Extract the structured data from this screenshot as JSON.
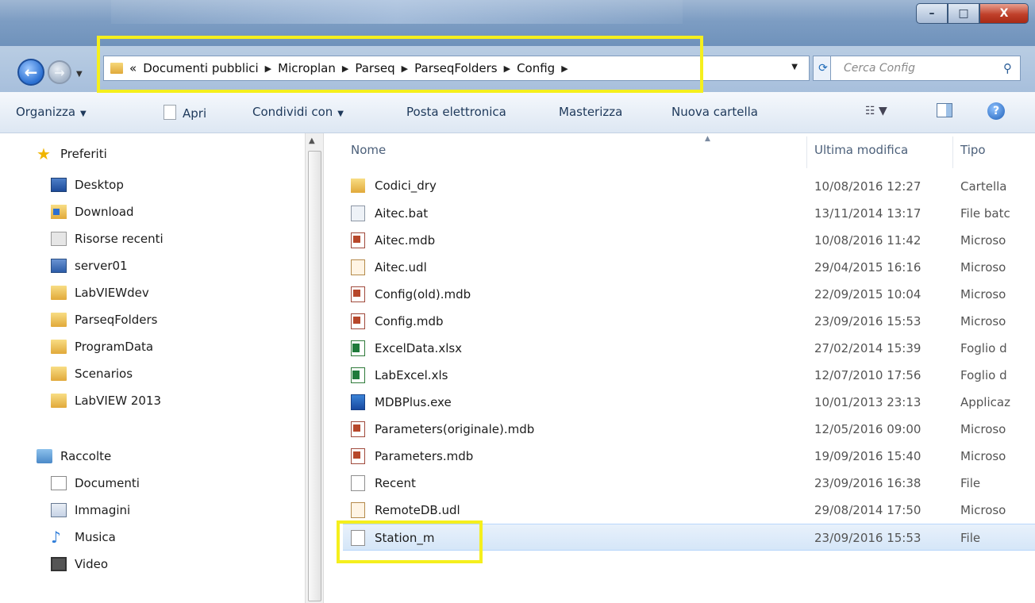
{
  "window": {
    "minimize_glyph": "–",
    "maximize_glyph": "□",
    "close_glyph": "X"
  },
  "nav": {
    "back_glyph": "←",
    "forward_glyph": "→",
    "address_prefix": "«",
    "breadcrumbs": [
      "Documenti pubblici",
      "Microplan",
      "Parseq",
      "ParseqFolders",
      "Config"
    ],
    "separator": "▶",
    "search_placeholder": "Cerca Config"
  },
  "toolbar": {
    "organize": "Organizza",
    "open": "Apri",
    "share": "Condividi con",
    "email": "Posta elettronica",
    "burn": "Masterizza",
    "new_folder": "Nuova cartella"
  },
  "sidebar": {
    "favorites_label": "Preferiti",
    "favorites": [
      {
        "label": "Desktop",
        "icon": "desktop-icon"
      },
      {
        "label": "Download",
        "icon": "download-folder-icon"
      },
      {
        "label": "Risorse recenti",
        "icon": "recent-places-icon"
      },
      {
        "label": "server01",
        "icon": "server-icon"
      },
      {
        "label": "LabVIEWdev",
        "icon": "folder-icon"
      },
      {
        "label": "ParseqFolders",
        "icon": "folder-icon"
      },
      {
        "label": "ProgramData",
        "icon": "folder-icon"
      },
      {
        "label": "Scenarios",
        "icon": "folder-icon"
      },
      {
        "label": "LabVIEW 2013",
        "icon": "folder-icon"
      }
    ],
    "libraries_label": "Raccolte",
    "libraries": [
      {
        "label": "Documenti",
        "icon": "documents-icon"
      },
      {
        "label": "Immagini",
        "icon": "pictures-icon"
      },
      {
        "label": "Musica",
        "icon": "music-icon"
      },
      {
        "label": "Video",
        "icon": "video-icon"
      }
    ]
  },
  "columns": {
    "name": "Nome",
    "modified": "Ultima modifica",
    "type": "Tipo"
  },
  "files": [
    {
      "name": "Codici_dry",
      "modified": "10/08/2016 12:27",
      "type": "Cartella",
      "icon": "folder-icon"
    },
    {
      "name": "Aitec.bat",
      "modified": "13/11/2014 13:17",
      "type": "File batc",
      "icon": "batch-file-icon"
    },
    {
      "name": "Aitec.mdb",
      "modified": "10/08/2016 11:42",
      "type": "Microso",
      "icon": "access-db-icon"
    },
    {
      "name": "Aitec.udl",
      "modified": "29/04/2015 16:16",
      "type": "Microso",
      "icon": "udl-file-icon"
    },
    {
      "name": "Config(old).mdb",
      "modified": "22/09/2015 10:04",
      "type": "Microso",
      "icon": "access-db-icon"
    },
    {
      "name": "Config.mdb",
      "modified": "23/09/2016 15:53",
      "type": "Microso",
      "icon": "access-db-icon"
    },
    {
      "name": "ExcelData.xlsx",
      "modified": "27/02/2014 15:39",
      "type": "Foglio d",
      "icon": "excel-file-icon"
    },
    {
      "name": "LabExcel.xls",
      "modified": "12/07/2010 17:56",
      "type": "Foglio d",
      "icon": "excel-file-icon"
    },
    {
      "name": "MDBPlus.exe",
      "modified": "10/01/2013 23:13",
      "type": "Applicaz",
      "icon": "exe-file-icon"
    },
    {
      "name": "Parameters(originale).mdb",
      "modified": "12/05/2016 09:00",
      "type": "Microso",
      "icon": "access-db-icon"
    },
    {
      "name": "Parameters.mdb",
      "modified": "19/09/2016 15:40",
      "type": "Microso",
      "icon": "access-db-icon"
    },
    {
      "name": "Recent",
      "modified": "23/09/2016 16:38",
      "type": "File",
      "icon": "file-icon"
    },
    {
      "name": "RemoteDB.udl",
      "modified": "29/08/2014 17:50",
      "type": "Microso",
      "icon": "udl-file-icon"
    },
    {
      "name": "Station_m",
      "modified": "23/09/2016 15:53",
      "type": "File",
      "icon": "file-icon",
      "selected": true
    }
  ],
  "colors": {
    "highlight": "#f5ef1d",
    "selection": "#d5e6f8"
  }
}
